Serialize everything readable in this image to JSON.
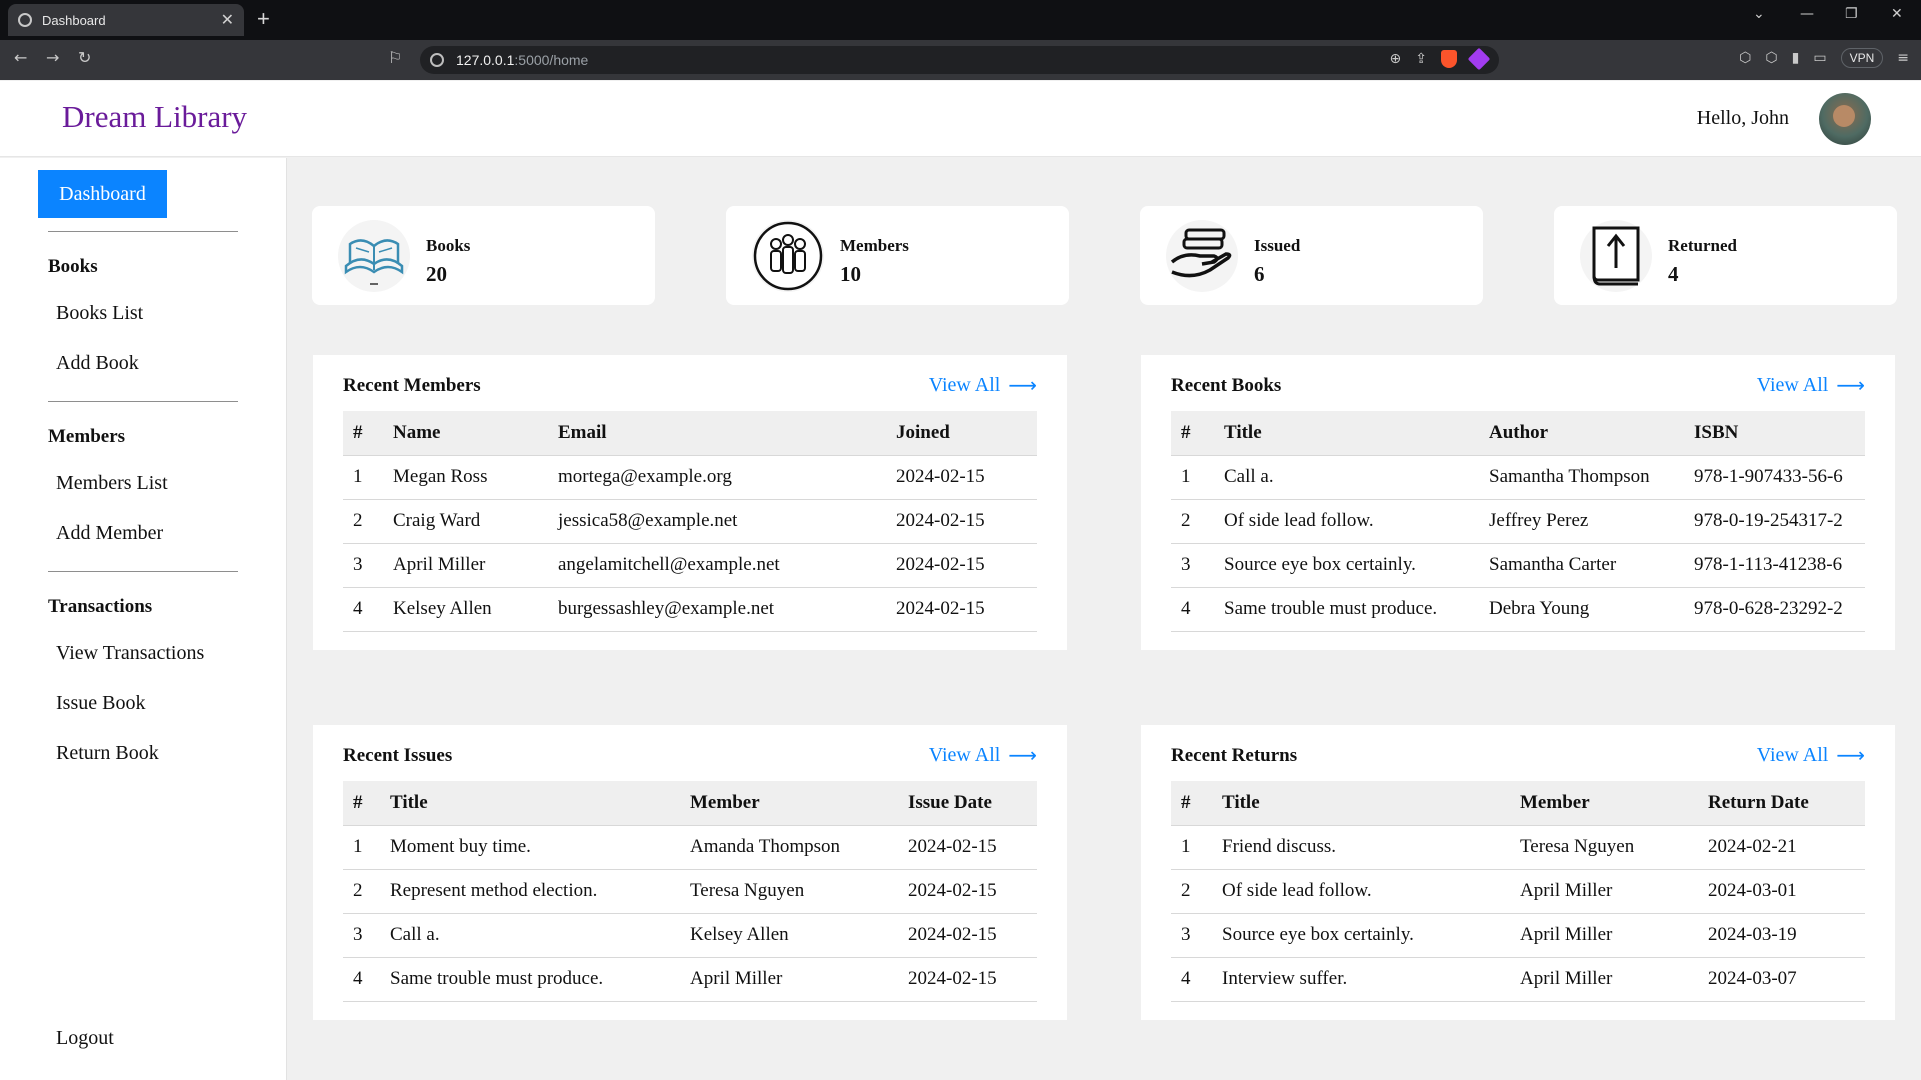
{
  "browser": {
    "tab_title": "Dashboard",
    "tab_close": "✕",
    "new_tab": "+",
    "url_host": "127.0.0.1",
    "url_path": ":5000/home",
    "vpn_label": "VPN"
  },
  "header": {
    "brand": "Dream Library",
    "greeting": "Hello, John"
  },
  "sidebar": {
    "dashboard": "Dashboard",
    "books_heading": "Books",
    "books_list": "Books List",
    "add_book": "Add Book",
    "members_heading": "Members",
    "members_list": "Members List",
    "add_member": "Add Member",
    "transactions_heading": "Transactions",
    "view_transactions": "View Transactions",
    "issue_book": "Issue Book",
    "return_book": "Return Book",
    "logout": "Logout"
  },
  "stats": [
    {
      "label": "Books",
      "value": "20",
      "icon": "open-book-icon"
    },
    {
      "label": "Members",
      "value": "10",
      "icon": "members-group-icon"
    },
    {
      "label": "Issued",
      "value": "6",
      "icon": "hand-book-icon"
    },
    {
      "label": "Returned",
      "value": "4",
      "icon": "return-book-icon"
    }
  ],
  "view_all": "View All",
  "recent_members": {
    "title": "Recent Members",
    "headers": [
      "#",
      "Name",
      "Email",
      "Joined"
    ],
    "rows": [
      [
        "1",
        "Megan Ross",
        "mortega@example.org",
        "2024-02-15"
      ],
      [
        "2",
        "Craig Ward",
        "jessica58@example.net",
        "2024-02-15"
      ],
      [
        "3",
        "April Miller",
        "angelamitchell@example.net",
        "2024-02-15"
      ],
      [
        "4",
        "Kelsey Allen",
        "burgessashley@example.net",
        "2024-02-15"
      ]
    ]
  },
  "recent_books": {
    "title": "Recent Books",
    "headers": [
      "#",
      "Title",
      "Author",
      "ISBN"
    ],
    "rows": [
      [
        "1",
        "Call a.",
        "Samantha Thompson",
        "978-1-907433-56-6"
      ],
      [
        "2",
        "Of side lead follow.",
        "Jeffrey Perez",
        "978-0-19-254317-2"
      ],
      [
        "3",
        "Source eye box certainly.",
        "Samantha Carter",
        "978-1-113-41238-6"
      ],
      [
        "4",
        "Same trouble must produce.",
        "Debra Young",
        "978-0-628-23292-2"
      ]
    ]
  },
  "recent_issues": {
    "title": "Recent Issues",
    "headers": [
      "#",
      "Title",
      "Member",
      "Issue Date"
    ],
    "rows": [
      [
        "1",
        "Moment buy time.",
        "Amanda Thompson",
        "2024-02-15"
      ],
      [
        "2",
        "Represent method election.",
        "Teresa Nguyen",
        "2024-02-15"
      ],
      [
        "3",
        "Call a.",
        "Kelsey Allen",
        "2024-02-15"
      ],
      [
        "4",
        "Same trouble must produce.",
        "April Miller",
        "2024-02-15"
      ]
    ]
  },
  "recent_returns": {
    "title": "Recent Returns",
    "headers": [
      "#",
      "Title",
      "Member",
      "Return Date"
    ],
    "rows": [
      [
        "1",
        "Friend discuss.",
        "Teresa Nguyen",
        "2024-02-21"
      ],
      [
        "2",
        "Of side lead follow.",
        "April Miller",
        "2024-03-01"
      ],
      [
        "3",
        "Source eye box certainly.",
        "April Miller",
        "2024-03-19"
      ],
      [
        "4",
        "Interview suffer.",
        "April Miller",
        "2024-03-07"
      ]
    ]
  }
}
